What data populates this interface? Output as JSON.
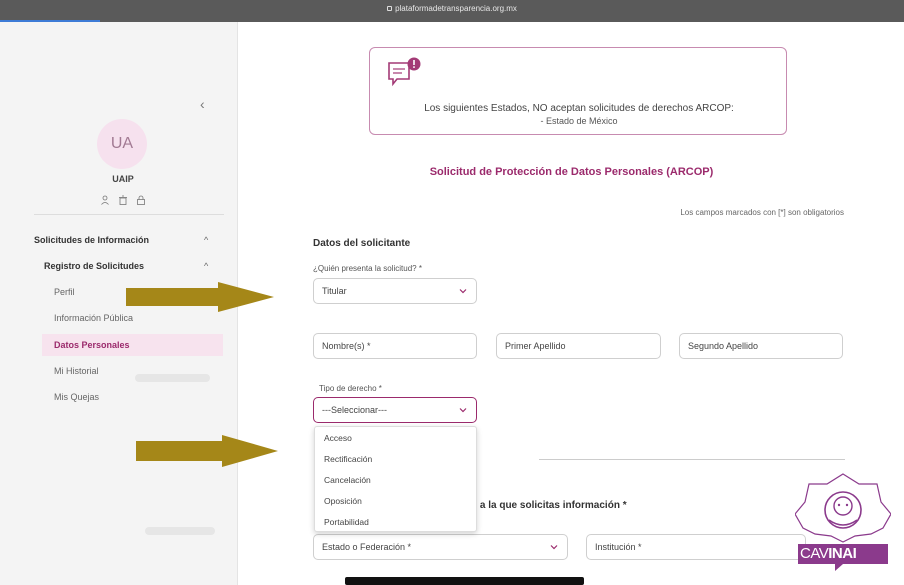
{
  "browser": {
    "url": "plataformadetransparencia.org.mx"
  },
  "sidebar": {
    "avatar_initials": "UA",
    "user_name": "UAIP",
    "menu": {
      "solicitudes_info": "Solicitudes de Información",
      "registro": "Registro de Solicitudes",
      "perfil": "Perfil",
      "info_publica": "Información Pública",
      "datos_personales": "Datos Personales",
      "mi_historial": "Mi Historial",
      "mis_quejas": "Mis Quejas"
    }
  },
  "notice": {
    "line1": "Los siguientes Estados, NO aceptan solicitudes de derechos ARCOP:",
    "line2": "- Estado de México"
  },
  "form": {
    "title": "Solicitud de Protección de Datos Personales (ARCOP)",
    "required_note": "Los campos marcados con [*] son obligatorios",
    "section_solicitante": "Datos del solicitante",
    "quien_label": "¿Quién presenta la solicitud? *",
    "quien_value": "Titular",
    "nombre_placeholder": "Nombre(s) *",
    "primer_apellido_placeholder": "Primer Apellido",
    "segundo_apellido_placeholder": "Segundo Apellido",
    "tipo_label": "Tipo de derecho *",
    "tipo_value": "---Seleccionar---",
    "tipo_options": [
      "Acceso",
      "Rectificación",
      "Cancelación",
      "Oposición",
      "Portabilidad"
    ],
    "section_institucion": "n a la que solicitas información *",
    "estado_value": "Estado o Federación *",
    "institucion_value": "Institución *"
  },
  "logo": {
    "text_cav": "CAV",
    "text_inai": "INAI"
  },
  "colors": {
    "accent": "#9b2a6c",
    "arrow": "#a58718",
    "sidebar_bg": "#f4f4f4"
  }
}
